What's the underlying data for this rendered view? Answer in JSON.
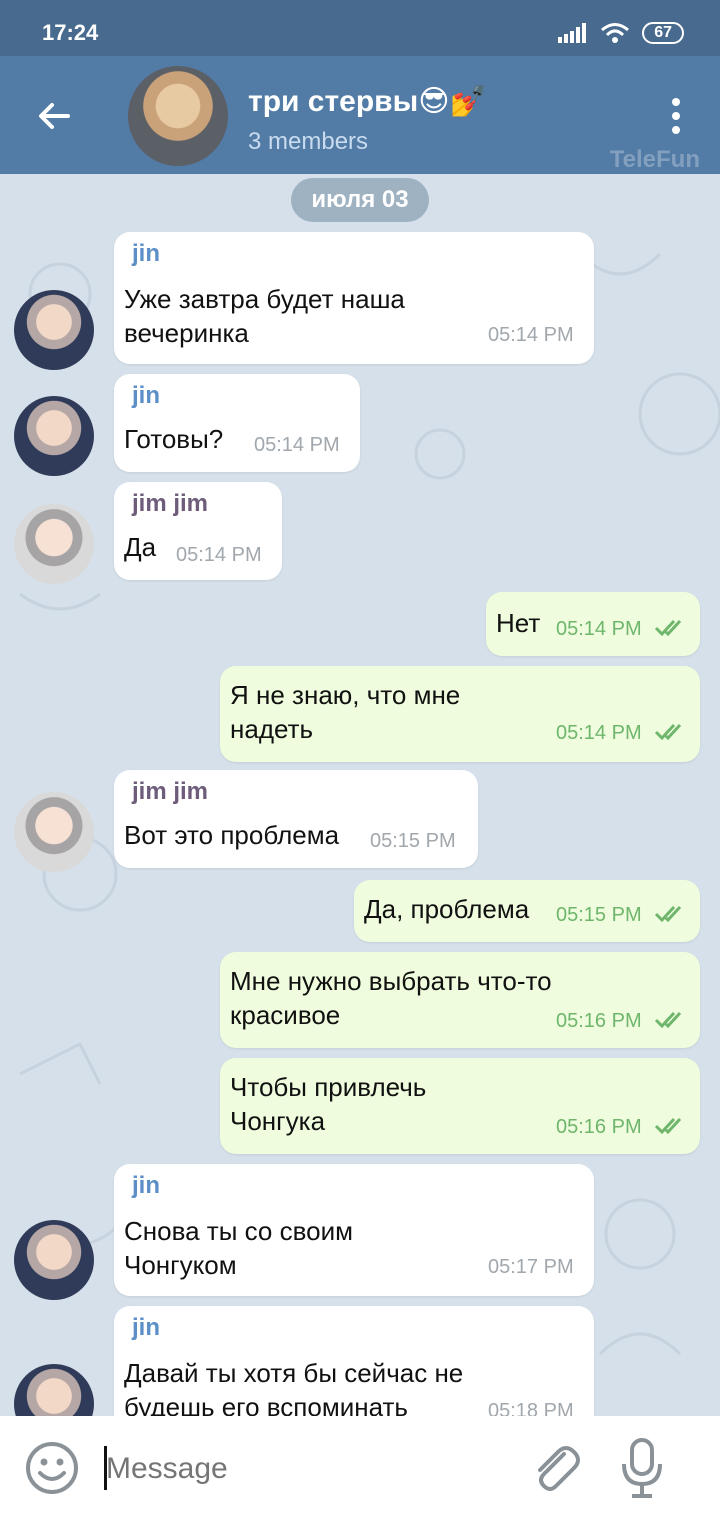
{
  "status_bar": {
    "time": "17:24",
    "battery": "67"
  },
  "header": {
    "title": "три стервы😎💅",
    "members": "3 members",
    "watermark": "TeleFun"
  },
  "chat": {
    "date_label": "июля 03",
    "messages": [
      {
        "side": "in",
        "author": "jin",
        "author_color": "#5c8fc8",
        "text": "Уже завтра будет наша\nвечеринка",
        "time": "05:14 PM"
      },
      {
        "side": "in",
        "author": "jin",
        "author_color": "#5c8fc8",
        "text": "Готовы?",
        "time": "05:14 PM"
      },
      {
        "side": "in",
        "author": "jim jim",
        "author_color": "#6d5d7b",
        "text": "Да",
        "time": "05:14 PM"
      },
      {
        "side": "out",
        "text": "Нет",
        "time": "05:14 PM"
      },
      {
        "side": "out",
        "text": "Я не знаю, что мне\nнадеть",
        "time": "05:14 PM"
      },
      {
        "side": "in",
        "author": "jim jim",
        "author_color": "#6d5d7b",
        "text": "Вот это проблема",
        "time": "05:15 PM"
      },
      {
        "side": "out",
        "text": "Да, проблема",
        "time": "05:15 PM"
      },
      {
        "side": "out",
        "text": "Мне нужно выбрать что-то\nкрасивое",
        "time": "05:16 PM"
      },
      {
        "side": "out",
        "text": "Чтобы привлечь\nЧонгука",
        "time": "05:16 PM"
      },
      {
        "side": "in",
        "author": "jin",
        "author_color": "#5c8fc8",
        "text": "Снова ты со своим\nЧонгуком",
        "time": "05:17 PM"
      },
      {
        "side": "in",
        "author": "jin",
        "author_color": "#5c8fc8",
        "text": "Давай ты хотя бы сейчас не\nбудешь его вспоминать",
        "time": "05:18 PM"
      }
    ]
  },
  "input": {
    "placeholder": "Message"
  },
  "colors": {
    "header": "#527ba6",
    "status_bar": "#476a8e",
    "out_bubble": "#effdde",
    "in_bubble": "#ffffff",
    "check": "#6fb66c"
  }
}
